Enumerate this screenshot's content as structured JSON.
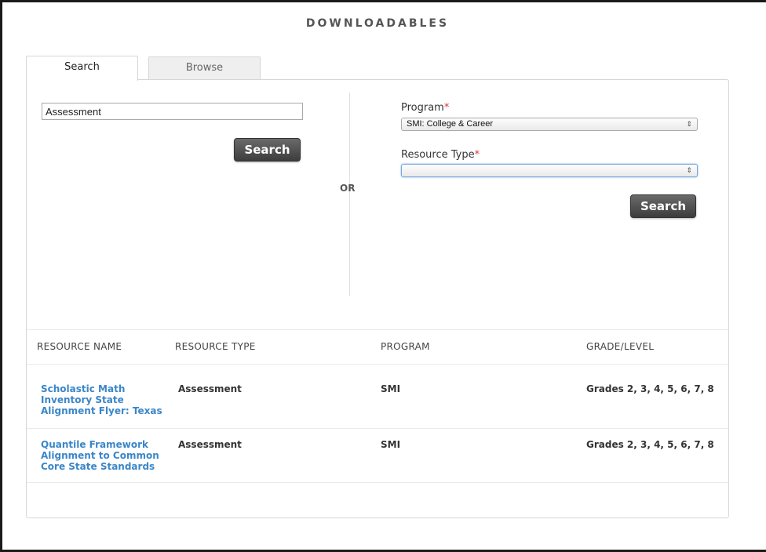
{
  "page": {
    "title": "DOWNLOADABLES"
  },
  "tabs": [
    {
      "label": "Search",
      "active": true
    },
    {
      "label": "Browse",
      "active": false
    }
  ],
  "search": {
    "keyword_value": "Assessment",
    "search_button": "Search",
    "or_label": "OR"
  },
  "filters": {
    "program_label": "Program",
    "program_value": "SMI: College & Career",
    "resource_type_label": "Resource Type",
    "resource_type_value": "",
    "required_mark": "*",
    "search_button": "Search"
  },
  "results": {
    "columns": [
      "RESOURCE NAME",
      "RESOURCE TYPE",
      "PROGRAM",
      "GRADE/LEVEL"
    ],
    "rows": [
      {
        "name": "Scholastic Math Inventory State Alignment Flyer: Texas",
        "type": "Assessment",
        "program": "SMI",
        "grade": "Grades 2, 3, 4, 5, 6, 7, 8"
      },
      {
        "name": "Quantile Framework Alignment to Common Core State Standards",
        "type": "Assessment",
        "program": "SMI",
        "grade": "Grades 2, 3, 4, 5, 6, 7, 8"
      }
    ]
  },
  "colors": {
    "link": "#3a86c8",
    "required": "#dd3333",
    "button_bg": "#4a4a4a"
  }
}
